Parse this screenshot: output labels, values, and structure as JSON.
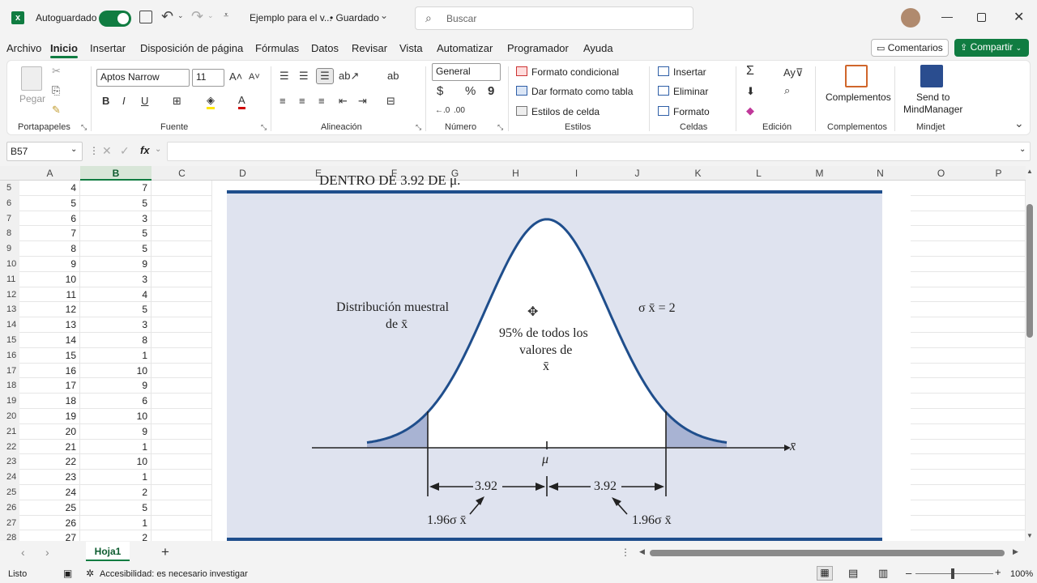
{
  "title_bar": {
    "autosave_label": "Autoguardado",
    "file_name": "Ejemplo para el v...",
    "save_state": "• Guardado",
    "search_placeholder": "Buscar"
  },
  "menu_tabs": [
    "Archivo",
    "Inicio",
    "Insertar",
    "Disposición de página",
    "Fórmulas",
    "Datos",
    "Revisar",
    "Vista",
    "Automatizar",
    "Programador",
    "Ayuda"
  ],
  "actions": {
    "comments": "Comentarios",
    "share": "Compartir"
  },
  "ribbon": {
    "clipboard": {
      "paste": "Pegar",
      "label": "Portapapeles"
    },
    "font": {
      "name": "Aptos Narrow",
      "size": "11",
      "label": "Fuente",
      "bold": "B",
      "italic": "I",
      "underline": "U"
    },
    "alignment": {
      "label": "Alineación"
    },
    "number": {
      "format": "General",
      "currency": "$",
      "percent": "%",
      "comma": "9",
      "label": "Número"
    },
    "styles": {
      "conditional": "Formato condicional",
      "table": "Dar formato como tabla",
      "cell_styles": "Estilos de celda",
      "label": "Estilos"
    },
    "cells": {
      "insert": "Insertar",
      "delete": "Eliminar",
      "format": "Formato",
      "label": "Celdas"
    },
    "editing": {
      "label": "Edición"
    },
    "addins": {
      "button": "Complementos",
      "label": "Complementos"
    },
    "mindjet": {
      "button_line1": "Send to",
      "button_line2": "MindManager",
      "label": "Mindjet"
    }
  },
  "formula_bar": {
    "name_box": "B57",
    "fx": "fx",
    "formula": ""
  },
  "columns": [
    "A",
    "B",
    "C",
    "D",
    "E",
    "F",
    "G",
    "H",
    "I",
    "J",
    "K",
    "L",
    "M",
    "N",
    "O",
    "P"
  ],
  "rows": [
    {
      "n": "5",
      "a": "4",
      "b": "7"
    },
    {
      "n": "6",
      "a": "5",
      "b": "5"
    },
    {
      "n": "7",
      "a": "6",
      "b": "3"
    },
    {
      "n": "8",
      "a": "7",
      "b": "5"
    },
    {
      "n": "9",
      "a": "8",
      "b": "5"
    },
    {
      "n": "10",
      "a": "9",
      "b": "9"
    },
    {
      "n": "11",
      "a": "10",
      "b": "3"
    },
    {
      "n": "12",
      "a": "11",
      "b": "4"
    },
    {
      "n": "13",
      "a": "12",
      "b": "5"
    },
    {
      "n": "14",
      "a": "13",
      "b": "3"
    },
    {
      "n": "15",
      "a": "14",
      "b": "8"
    },
    {
      "n": "16",
      "a": "15",
      "b": "1"
    },
    {
      "n": "17",
      "a": "16",
      "b": "10"
    },
    {
      "n": "18",
      "a": "17",
      "b": "9"
    },
    {
      "n": "19",
      "a": "18",
      "b": "6"
    },
    {
      "n": "20",
      "a": "19",
      "b": "10"
    },
    {
      "n": "21",
      "a": "20",
      "b": "9"
    },
    {
      "n": "22",
      "a": "21",
      "b": "1"
    },
    {
      "n": "23",
      "a": "22",
      "b": "10"
    },
    {
      "n": "24",
      "a": "23",
      "b": "1"
    },
    {
      "n": "25",
      "a": "24",
      "b": "2"
    },
    {
      "n": "26",
      "a": "25",
      "b": "5"
    },
    {
      "n": "27",
      "a": "26",
      "b": "1"
    },
    {
      "n": "28",
      "a": "27",
      "b": "2"
    }
  ],
  "figure": {
    "top_cut_text": "DENTRO DE 3.92 DE μ.",
    "dist_label_1": "Distribución muestral",
    "dist_label_2": "de x̄",
    "sigma_label": "σ x̄ = 2",
    "center_1": "95% de todos los",
    "center_2": "valores de",
    "center_3": "x̄",
    "mu": "μ",
    "axis_label": "x̄",
    "left_dist": "3.92",
    "right_dist": "3.92",
    "left_sigma": "1.96σ x̄",
    "right_sigma": "1.96σ x̄",
    "colors": {
      "bg": "#dfe3ef",
      "curve": "#1f4e8c",
      "tail": "#a8b3d3",
      "rule": "#1f4e8c"
    }
  },
  "sheet_tab": "Hoja1",
  "status": {
    "ready": "Listo",
    "accessibility": "Accesibilidad: es necesario investigar",
    "zoom": "100%"
  }
}
